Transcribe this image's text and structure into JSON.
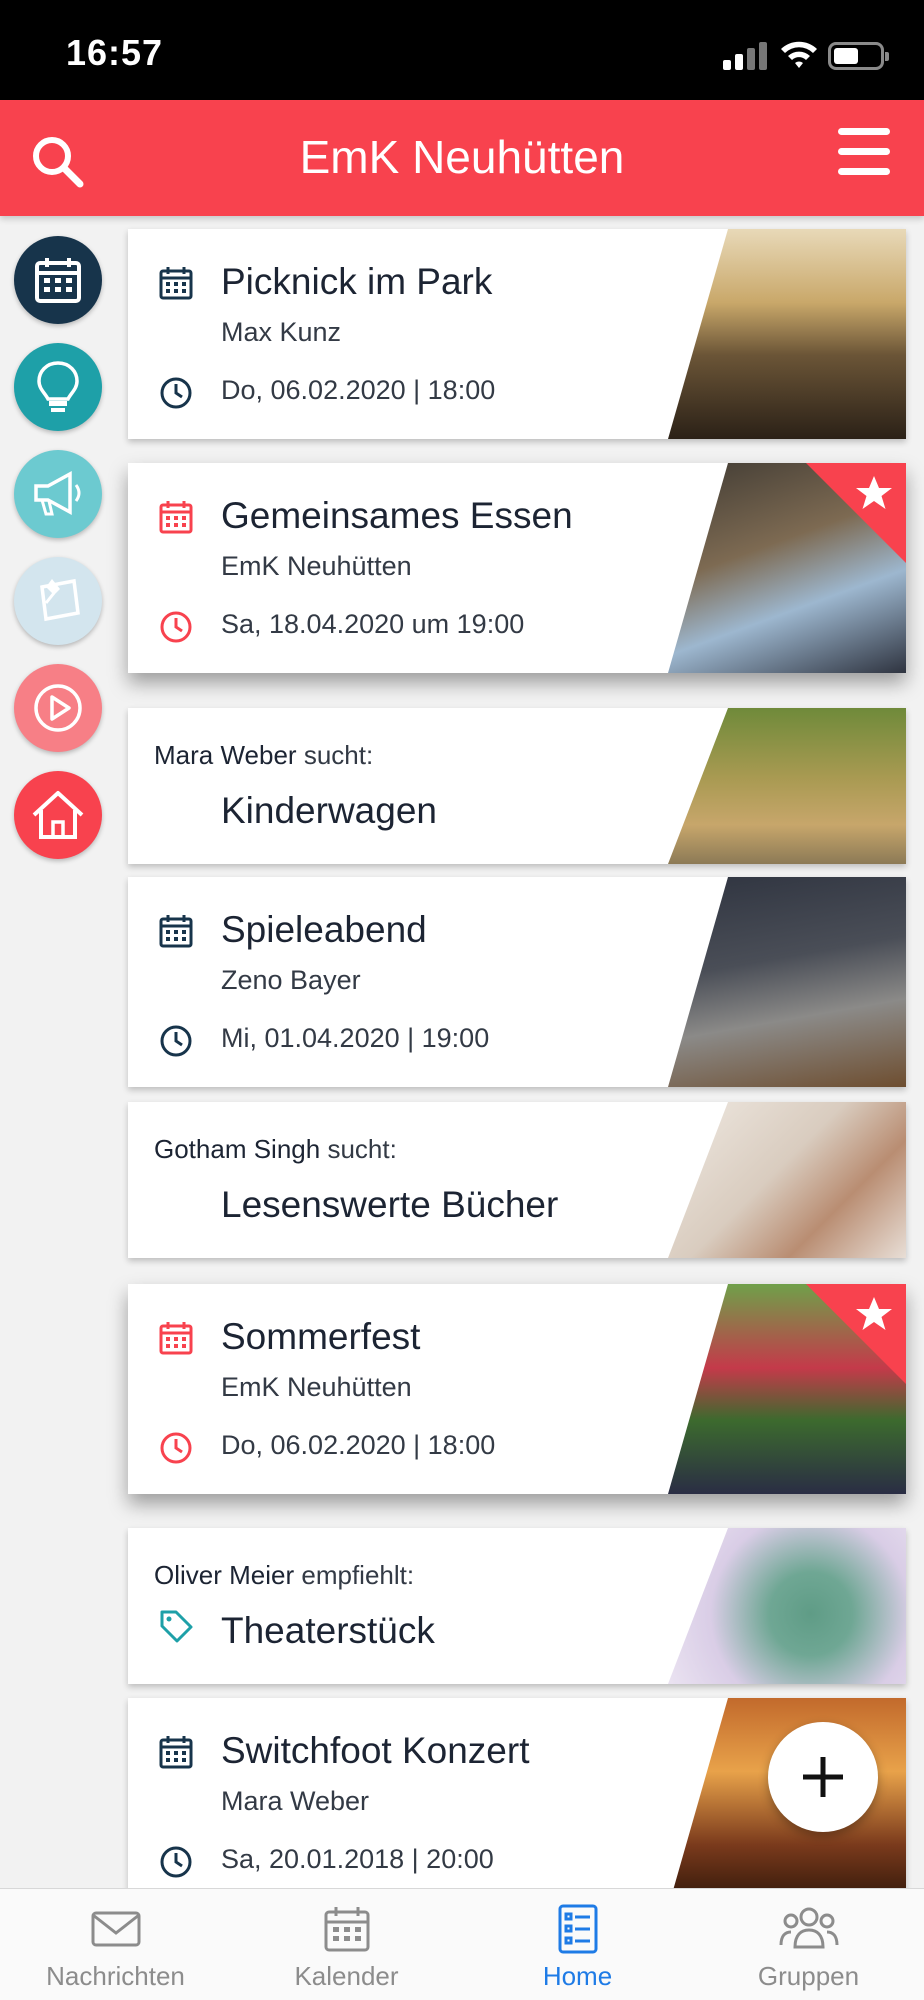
{
  "status_bar": {
    "time": "16:57"
  },
  "header": {
    "title": "EmK Neuhütten"
  },
  "side_menu": [
    {
      "name": "calendar",
      "color": "#17344b"
    },
    {
      "name": "ideas",
      "color": "#1ea0a8"
    },
    {
      "name": "announcements",
      "color": "#6ccad0"
    },
    {
      "name": "notes",
      "color": "#d3e5ee"
    },
    {
      "name": "media",
      "color": "#f77f86"
    },
    {
      "name": "home",
      "color": "#f8424e"
    }
  ],
  "cards": [
    {
      "type": "event",
      "title": "Picknick im Park",
      "subtitle": "Max Kunz",
      "date": "Do, 06.02.2020 | 18:00",
      "featured": false
    },
    {
      "type": "event",
      "title": "Gemeinsames Essen",
      "subtitle": "EmK Neuhütten",
      "date": "Sa, 18.04.2020 um 19:00",
      "featured": true
    },
    {
      "type": "search",
      "person": "Mara Weber",
      "verb": "sucht:",
      "title": "Kinderwagen"
    },
    {
      "type": "event",
      "title": "Spieleabend",
      "subtitle": "Zeno Bayer",
      "date": "Mi, 01.04.2020 | 19:00",
      "featured": false
    },
    {
      "type": "search",
      "person": "Gotham Singh",
      "verb": "sucht:",
      "title": "Lesenswerte Bücher"
    },
    {
      "type": "event",
      "title": "Sommerfest",
      "subtitle": "EmK Neuhütten",
      "date": "Do, 06.02.2020 | 18:00",
      "featured": true
    },
    {
      "type": "recommend",
      "person": "Oliver Meier",
      "verb": "empfiehlt:",
      "title": "Theaterstück"
    },
    {
      "type": "event",
      "title": "Switchfoot Konzert",
      "subtitle": "Mara Weber",
      "date": "Sa, 20.01.2018 | 20:00",
      "featured": false
    }
  ],
  "bottom_nav": [
    {
      "label": "Nachrichten",
      "icon": "mail-icon",
      "active": false
    },
    {
      "label": "Kalender",
      "icon": "calendar-icon",
      "active": false
    },
    {
      "label": "Home",
      "icon": "list-icon",
      "active": true
    },
    {
      "label": "Gruppen",
      "icon": "group-icon",
      "active": false
    }
  ],
  "colors": {
    "accent": "#f8424e",
    "navy": "#17344b",
    "active_nav": "#1e7be6"
  }
}
